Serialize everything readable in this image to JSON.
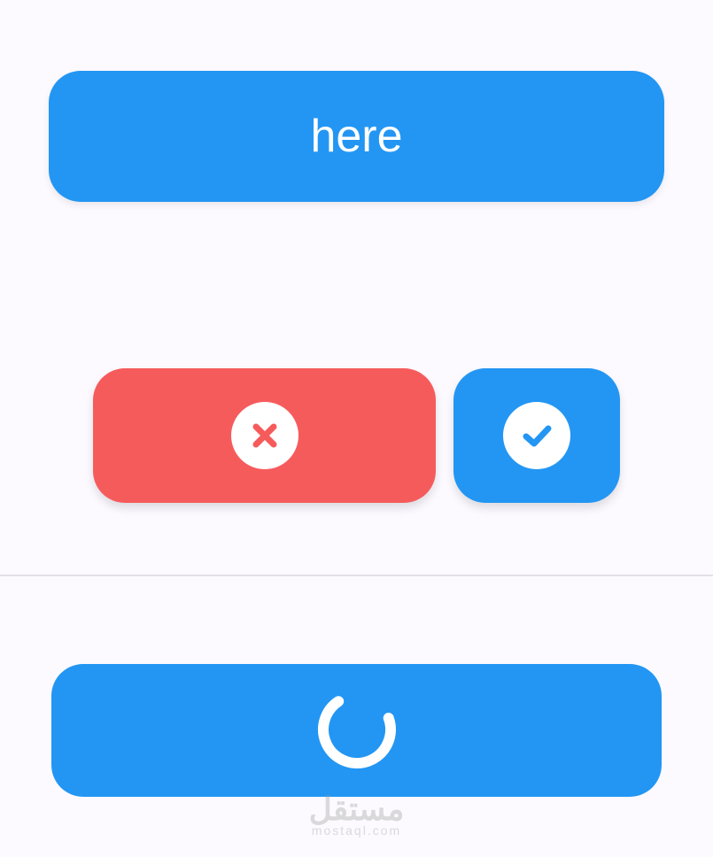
{
  "primary": {
    "label": "here"
  },
  "actions": {
    "cancel_icon": "x-icon",
    "confirm_icon": "check-icon"
  },
  "loading": {
    "state": "loading"
  },
  "watermark": {
    "brand": "مستقل",
    "domain": "mostaql.com"
  },
  "colors": {
    "primary": "#2396f3",
    "danger": "#f65b5c",
    "background": "#fcfaff"
  }
}
